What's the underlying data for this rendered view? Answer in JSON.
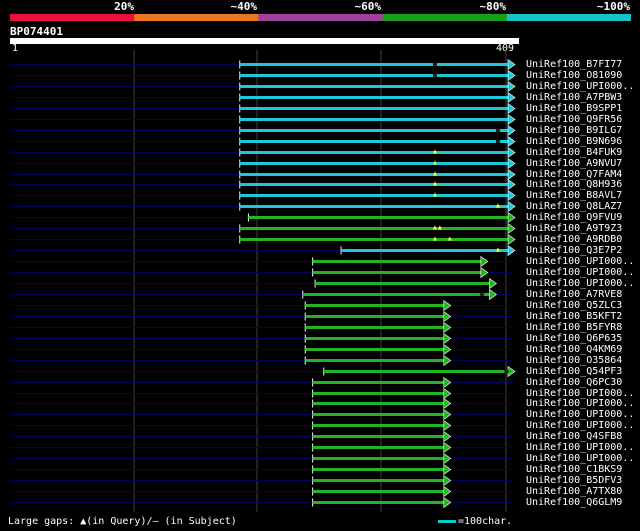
{
  "legend": {
    "labels": [
      "20%",
      "~40%",
      "~60%",
      "~80%",
      "~100%"
    ],
    "colors": [
      "#e8103c",
      "#e87820",
      "#a040a0",
      "#18a018",
      "#18c0c8"
    ]
  },
  "query": {
    "id": "BP074401",
    "start": "1",
    "end": "409",
    "length": 409
  },
  "colors": {
    "cyan": "#1ec8d8",
    "green": "#22b422",
    "background_line": "#000060",
    "grid": "#404040"
  },
  "hits": [
    {
      "id": "UniRef100_B7FI77",
      "color": "cyan",
      "start": 187,
      "end": 409,
      "marks": [
        {
          "pos": 345,
          "type": "dash"
        }
      ]
    },
    {
      "id": "UniRef100_O81090",
      "color": "cyan",
      "start": 187,
      "end": 409,
      "marks": [
        {
          "pos": 345,
          "type": "dash"
        }
      ]
    },
    {
      "id": "UniRef100_UPI000..",
      "color": "cyan",
      "start": 187,
      "end": 409,
      "marks": []
    },
    {
      "id": "UniRef100_A7PBW3",
      "color": "cyan",
      "start": 187,
      "end": 409,
      "marks": []
    },
    {
      "id": "UniRef100_B9SPP1",
      "color": "cyan",
      "start": 187,
      "end": 409,
      "marks": []
    },
    {
      "id": "UniRef100_Q9FR56",
      "color": "cyan",
      "start": 187,
      "end": 409,
      "marks": []
    },
    {
      "id": "UniRef100_B9ILG7",
      "color": "cyan",
      "start": 187,
      "end": 409,
      "marks": [
        {
          "pos": 396,
          "type": "dash"
        }
      ]
    },
    {
      "id": "UniRef100_B9N696",
      "color": "cyan",
      "start": 187,
      "end": 409,
      "marks": [
        {
          "pos": 396,
          "type": "dash"
        }
      ]
    },
    {
      "id": "UniRef100_B4FUK9",
      "color": "cyan",
      "start": 187,
      "end": 409,
      "marks": [
        {
          "pos": 345,
          "type": "tri"
        }
      ]
    },
    {
      "id": "UniRef100_A9NVU7",
      "color": "cyan",
      "start": 187,
      "end": 409,
      "marks": [
        {
          "pos": 345,
          "type": "tri"
        }
      ]
    },
    {
      "id": "UniRef100_Q7FAM4",
      "color": "cyan",
      "start": 187,
      "end": 409,
      "marks": [
        {
          "pos": 345,
          "type": "tri"
        }
      ]
    },
    {
      "id": "UniRef100_Q8H936",
      "color": "cyan",
      "start": 187,
      "end": 409,
      "marks": [
        {
          "pos": 345,
          "type": "tri"
        }
      ]
    },
    {
      "id": "UniRef100_B8AVL7",
      "color": "cyan",
      "start": 187,
      "end": 409,
      "marks": [
        {
          "pos": 345,
          "type": "tri"
        }
      ]
    },
    {
      "id": "UniRef100_Q8LAZ7",
      "color": "cyan",
      "start": 187,
      "end": 409,
      "marks": [
        {
          "pos": 396,
          "type": "tri"
        }
      ]
    },
    {
      "id": "UniRef100_Q9FVU9",
      "color": "green",
      "start": 194,
      "end": 409,
      "marks": []
    },
    {
      "id": "UniRef100_A9T9Z3",
      "color": "green",
      "start": 187,
      "end": 409,
      "marks": [
        {
          "pos": 345,
          "type": "tri"
        },
        {
          "pos": 349,
          "type": "tri"
        }
      ]
    },
    {
      "id": "UniRef100_A9RDB0",
      "color": "green",
      "start": 187,
      "end": 409,
      "marks": [
        {
          "pos": 345,
          "type": "tri"
        },
        {
          "pos": 357,
          "type": "tri"
        }
      ]
    },
    {
      "id": "UniRef100_Q3E7P2",
      "color": "cyan",
      "start": 269,
      "end": 409,
      "marks": [
        {
          "pos": 396,
          "type": "tri"
        }
      ]
    },
    {
      "id": "UniRef100_UPI000..",
      "color": "green",
      "start": 246,
      "end": 387,
      "marks": []
    },
    {
      "id": "UniRef100_UPI000..",
      "color": "green",
      "start": 246,
      "end": 387,
      "marks": []
    },
    {
      "id": "UniRef100_UPI000..",
      "color": "green",
      "start": 248,
      "end": 394,
      "marks": []
    },
    {
      "id": "UniRef100_A7RVE8",
      "color": "green",
      "start": 238,
      "end": 394,
      "marks": [
        {
          "pos": 383,
          "type": "dash"
        }
      ]
    },
    {
      "id": "UniRef100_Q5ZLC3",
      "color": "green",
      "start": 240,
      "end": 357,
      "marks": []
    },
    {
      "id": "UniRef100_B5KFT2",
      "color": "green",
      "start": 240,
      "end": 357,
      "marks": []
    },
    {
      "id": "UniRef100_B5FYR8",
      "color": "green",
      "start": 240,
      "end": 357,
      "marks": []
    },
    {
      "id": "UniRef100_Q6P635",
      "color": "green",
      "start": 240,
      "end": 357,
      "marks": []
    },
    {
      "id": "UniRef100_Q4KM69",
      "color": "green",
      "start": 240,
      "end": 357,
      "marks": []
    },
    {
      "id": "UniRef100_O35864",
      "color": "green",
      "start": 240,
      "end": 357,
      "marks": []
    },
    {
      "id": "UniRef100_Q54PF3",
      "color": "green",
      "start": 255,
      "end": 409,
      "marks": [
        {
          "pos": 403,
          "type": "dash"
        }
      ]
    },
    {
      "id": "UniRef100_Q6PC30",
      "color": "green",
      "start": 246,
      "end": 357,
      "marks": []
    },
    {
      "id": "UniRef100_UPI000..",
      "color": "green",
      "start": 246,
      "end": 357,
      "marks": []
    },
    {
      "id": "UniRef100_UPI000..",
      "color": "green",
      "start": 246,
      "end": 357,
      "marks": []
    },
    {
      "id": "UniRef100_UPI000..",
      "color": "green",
      "start": 246,
      "end": 357,
      "marks": []
    },
    {
      "id": "UniRef100_UPI000..",
      "color": "green",
      "start": 246,
      "end": 357,
      "marks": []
    },
    {
      "id": "UniRef100_Q4SFB8",
      "color": "green",
      "start": 246,
      "end": 357,
      "marks": []
    },
    {
      "id": "UniRef100_UPI000..",
      "color": "green",
      "start": 246,
      "end": 357,
      "marks": []
    },
    {
      "id": "UniRef100_UPI000..",
      "color": "green",
      "start": 246,
      "end": 357,
      "marks": []
    },
    {
      "id": "UniRef100_C1BKS9",
      "color": "green",
      "start": 246,
      "end": 357,
      "marks": []
    },
    {
      "id": "UniRef100_B5DFV3",
      "color": "green",
      "start": 246,
      "end": 357,
      "marks": []
    },
    {
      "id": "UniRef100_A7TX80",
      "color": "green",
      "start": 246,
      "end": 357,
      "marks": []
    },
    {
      "id": "UniRef100_Q6GLM9",
      "color": "green",
      "start": 246,
      "end": 357,
      "marks": []
    }
  ],
  "footer": {
    "gaps_text": "Large gaps: ▲(in Query)/– (in Subject)",
    "scale_text": "=100char."
  }
}
